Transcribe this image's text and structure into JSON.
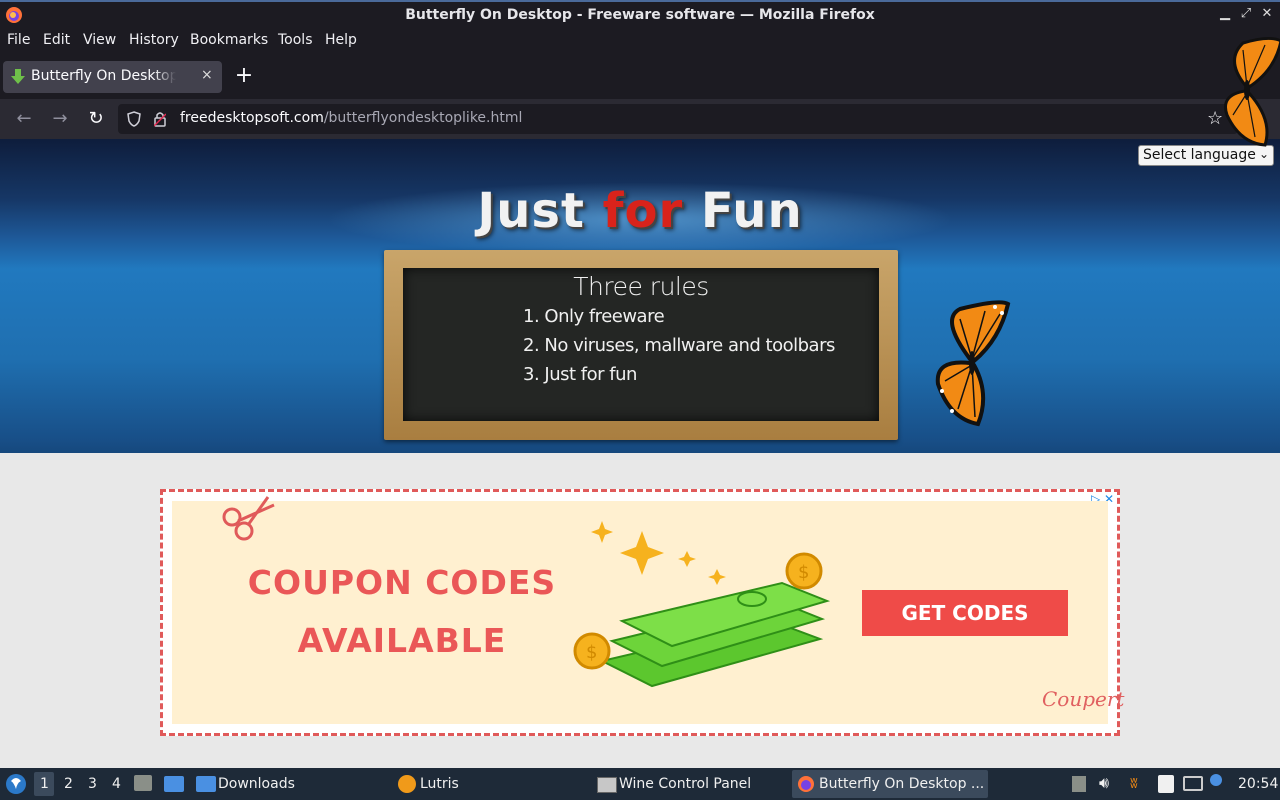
{
  "window": {
    "title": "Butterfly On Desktop - Freeware software — Mozilla Firefox",
    "minimize_icon": "minimize-icon",
    "maximize_icon": "maximize-icon",
    "close_icon": "close-icon"
  },
  "menu": {
    "items": [
      "File",
      "Edit",
      "View",
      "History",
      "Bookmarks",
      "Tools",
      "Help"
    ]
  },
  "tab": {
    "label": "Butterfly On Desktop - Freeware software",
    "close": "×",
    "new_tab": "+"
  },
  "urlbar": {
    "host": "freedesktopsoft.com",
    "path": "/butterflyondesktoplike.html"
  },
  "page": {
    "language_select": "Select language",
    "hero_title_part1": "Just ",
    "hero_title_part2": "for",
    "hero_title_part3": " Fun",
    "board_title": "Three rules",
    "rules": [
      "1. Only freeware",
      "2. No viruses, mallware and toolbars",
      "3. Just for fun"
    ]
  },
  "ad": {
    "line1": "COUPON CODES",
    "line2": "AVAILABLE",
    "button": "GET CODES",
    "brand": "Coupert",
    "close": "✕"
  },
  "taskbar": {
    "workspaces": [
      "1",
      "2",
      "3",
      "4"
    ],
    "items": [
      {
        "label": "Downloads"
      },
      {
        "label": "Lutris"
      },
      {
        "label": "Wine Control Panel"
      },
      {
        "label": "Butterfly On Desktop ..."
      }
    ],
    "clock": "20:54"
  },
  "colors": {
    "accent_red": "#d9231b",
    "ad_red": "#ea5757",
    "browser_dark": "#1c1b22"
  }
}
